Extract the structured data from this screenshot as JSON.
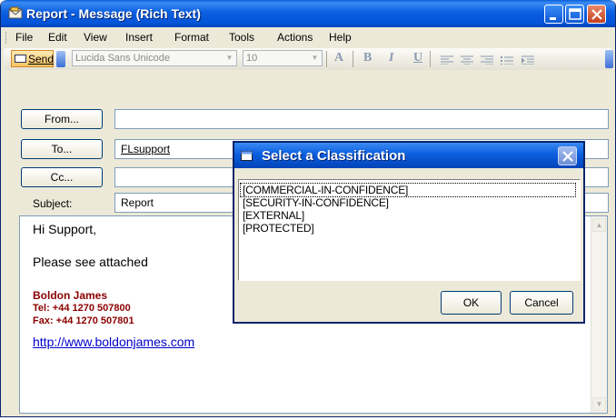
{
  "window": {
    "title": "Report - Message (Rich Text)"
  },
  "menu": {
    "items": [
      {
        "label": "File"
      },
      {
        "label": "Edit"
      },
      {
        "label": "View"
      },
      {
        "label": "Insert"
      },
      {
        "label": "Format"
      },
      {
        "label": "Tools"
      },
      {
        "label": "Actions"
      },
      {
        "label": "Help"
      }
    ]
  },
  "toolbar": {
    "send_label": "Send",
    "font_name": "Lucida Sans Unicode",
    "font_size": "10",
    "bold": "B",
    "italic": "I",
    "underline": "U",
    "font_color": "A"
  },
  "header": {
    "from_label": "From...",
    "from_value": "",
    "to_label": "To...",
    "to_value": "FLsupport",
    "cc_label": "Cc...",
    "cc_value": "",
    "subject_label": "Subject:",
    "subject_value": "Report"
  },
  "body": {
    "greeting": "Hi Support,",
    "line1": "Please see attached",
    "sig_name": "Boldon James",
    "sig_tel": "Tel: +44 1270 507800",
    "sig_fax": "Fax: +44 1270 507801",
    "link": "http://www.boldonjames.com"
  },
  "dialog": {
    "title": "Select a Classification",
    "options": [
      "[COMMERCIAL-IN-CONFIDENCE]",
      "[SECURITY-IN-CONFIDENCE]",
      "[EXTERNAL]",
      "[PROTECTED]"
    ],
    "ok_label": "OK",
    "cancel_label": "Cancel"
  },
  "colors": {
    "titlebar": "#0b5fe0",
    "signature": "#8b0000",
    "link": "#0000cc"
  }
}
